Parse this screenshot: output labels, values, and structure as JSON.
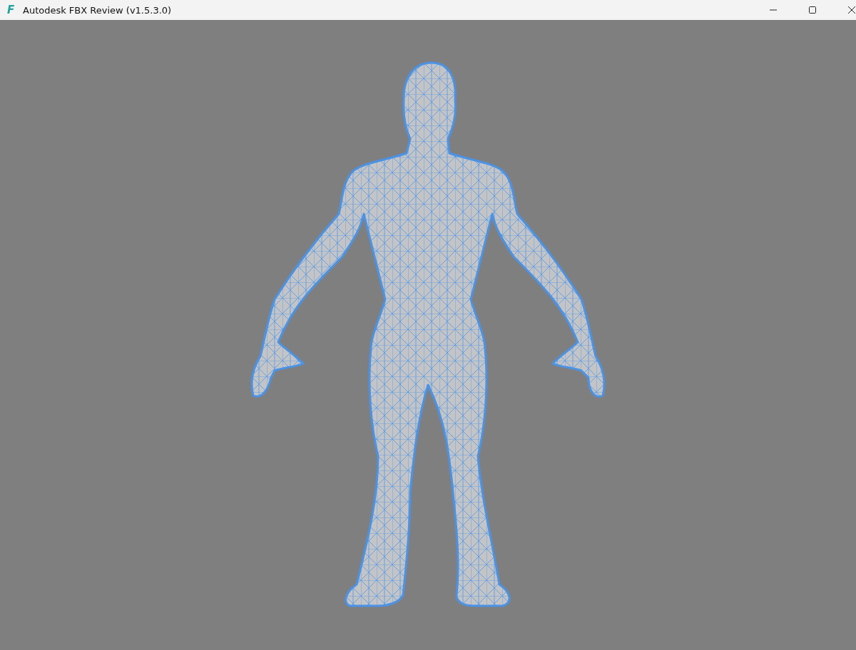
{
  "window": {
    "icon_letter": "F",
    "title": "Autodesk FBX Review (v1.5.3.0)"
  }
}
